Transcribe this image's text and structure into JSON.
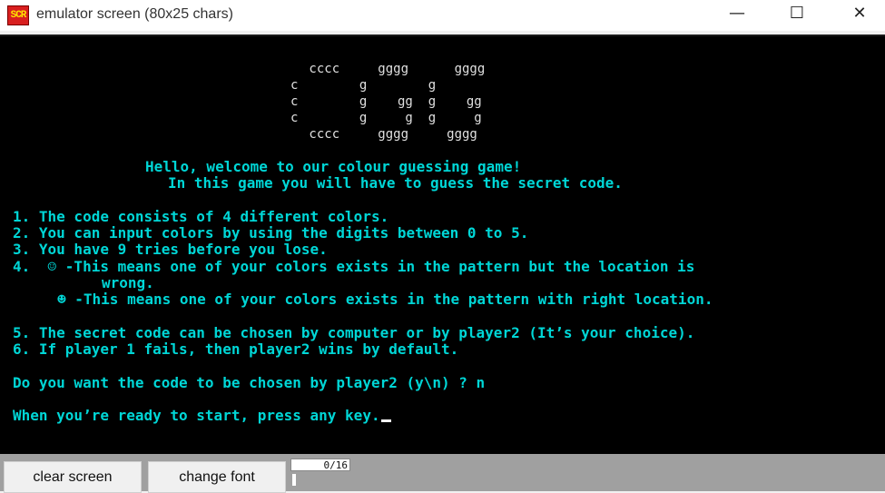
{
  "window": {
    "title": "emulator screen (80x25 chars)",
    "icon_label": "SCR",
    "controls": {
      "minimize": "—",
      "maximize": "☐",
      "close": "✕"
    }
  },
  "logo": [
    " cccc     gggg      gggg",
    "c        g        g",
    "c        g    gg  g    gg",
    "c        g     g  g     g",
    " cccc     gggg     gggg"
  ],
  "screen_lines": {
    "welcome": "Hello, welcome to our colour guessing game!",
    "intro": "In this game you will have to guess the secret code.",
    "rule1": "1. The code consists of 4 different colors.",
    "rule2": "2. You can input colors by using the digits between 0 to 5.",
    "rule3": "3. You have 9 tries before you lose.",
    "rule4a": "4.  ☺ -This means one of your colors exists in the pattern but the location is",
    "rule4b": "wrong.",
    "rule4c": "☻ -This means one of your colors exists in the pattern with right location.",
    "rule5": "5. The secret code can be chosen by computer or by player2 (It’s your choice).",
    "rule6": "6. If player 1 fails, then player2 wins by default.",
    "question": "Do you want the code to be chosen by player2 (y\\n) ? n",
    "prompt": "When you’re ready to start, press any key."
  },
  "toolbar": {
    "clear_label": "clear screen",
    "font_label": "change font",
    "counter": "0/16"
  },
  "colors": {
    "screen_bg": "#000000",
    "text": "#00d6d6",
    "logo": "#e0e0e0"
  }
}
